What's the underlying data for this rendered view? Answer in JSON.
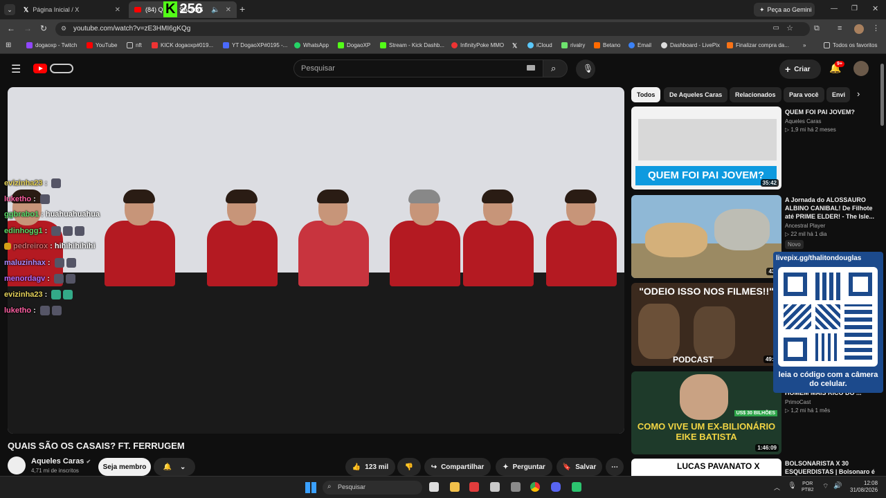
{
  "browser": {
    "tabs": [
      {
        "title": "Página Inicial / X",
        "active": false
      },
      {
        "title": "(84) QUAIS SÃO OS",
        "active": true
      }
    ],
    "new_tab": "+",
    "gemini_button": "Peça ao Gemini",
    "url": "youtube.com/watch?v=zE3HMI6gKQg",
    "bookmarks": [
      "dogaoxp - Twitch",
      "YouTube",
      "nft",
      "KICK dogaoxp#019...",
      "YT DogaoXP#0195 -...",
      "WhatsApp",
      "DogaoXP",
      "Stream - Kick Dashb...",
      "InfinityPoke MMO",
      "",
      "iCloud",
      "rivalry",
      "Betano",
      "Email",
      "Dashboard - LivePix",
      "Finalizar compra da..."
    ],
    "all_favorites": "Todos os favoritos"
  },
  "kick_overlay": {
    "logo": "K",
    "count": "256"
  },
  "youtube": {
    "search_placeholder": "Pesquisar",
    "create_label": "Criar",
    "notif_badge": "9+",
    "video_title": "QUAIS SÃO OS CASAIS? FT. FERRUGEM",
    "channel": {
      "name": "Aqueles Caras",
      "subs": "4,71 mi de inscritos",
      "join": "Seja membro"
    },
    "actions": {
      "likes": "123 mil",
      "share": "Compartilhar",
      "ask": "Perguntar",
      "save": "Salvar",
      "more": "⋯"
    }
  },
  "chat": [
    {
      "user": "evizinha23",
      "color": "#e6d35a",
      "msg": ""
    },
    {
      "user": "luketho",
      "color": "#ff5fa2",
      "msg": ""
    },
    {
      "user": "ggbrabo1",
      "color": "#5bdc6a",
      "msg": "huahuahuahua"
    },
    {
      "user": "edinhogg1",
      "color": "#5bdc6a",
      "msg": ""
    },
    {
      "user": "pedreirox",
      "color": "#d46a6a",
      "msg": "hihihihihihi"
    },
    {
      "user": "maluzinhax",
      "color": "#a98bff",
      "msg": ""
    },
    {
      "user": "menordagv",
      "color": "#b56bff",
      "msg": ""
    },
    {
      "user": "evizinha23",
      "color": "#e6d35a",
      "msg": ""
    },
    {
      "user": "luketho",
      "color": "#ff5fa2",
      "msg": ""
    }
  ],
  "chips": [
    "Todos",
    "De Aqueles Caras",
    "Relacionados",
    "Para você",
    "Envi"
  ],
  "sidebar_videos": [
    {
      "title": "QUEM FOI PAI JOVEM?",
      "channel": "Aqueles Caras",
      "stats": "▷ 1,9 mi  há 2 meses",
      "duration": "35:42",
      "thumb_text": "QUEM FOI PAI JOVEM?",
      "extra": ""
    },
    {
      "title": "A Jornada do ALOSSAURO ALBINO CANIBAL! De Filhote até PRIME ELDER! - The Isle...",
      "channel": "Ancestral Player",
      "stats": "▷ 22 mil  há 1 dia",
      "duration": "43:",
      "thumb_text": "",
      "extra": "Novo"
    },
    {
      "title": "",
      "channel": "",
      "stats": "",
      "duration": "49:3",
      "thumb_text": "\"ODEIO ISSO NOS FILMES!!\"",
      "extra": ""
    },
    {
      "title": "HOMEM MAIS RICO DO ...",
      "channel": "PrimoCast",
      "stats": "▷ 1,2 mi  há 1 mês",
      "duration": "1:46:09",
      "thumb_text": "COMO VIVE UM EX-BILIONÁRIO EIKE BATISTA",
      "extra": "US$ 30 BILHÕES"
    },
    {
      "title": "BOLSONARISTA X 30 ESQUERDISTAS | Bolsonaro é",
      "channel": "",
      "stats": "",
      "duration": "",
      "thumb_text": "LUCAS PAVANATO X",
      "extra": ""
    }
  ],
  "qr_overlay": {
    "header": "livepix.gg/thalitondouglas",
    "footer": "leia o código com a câmera do celular."
  },
  "taskbar": {
    "search": "Pesquisar",
    "lang": "POR",
    "layout": "PTB2",
    "time": "12:08",
    "date": "31/08/2026"
  }
}
